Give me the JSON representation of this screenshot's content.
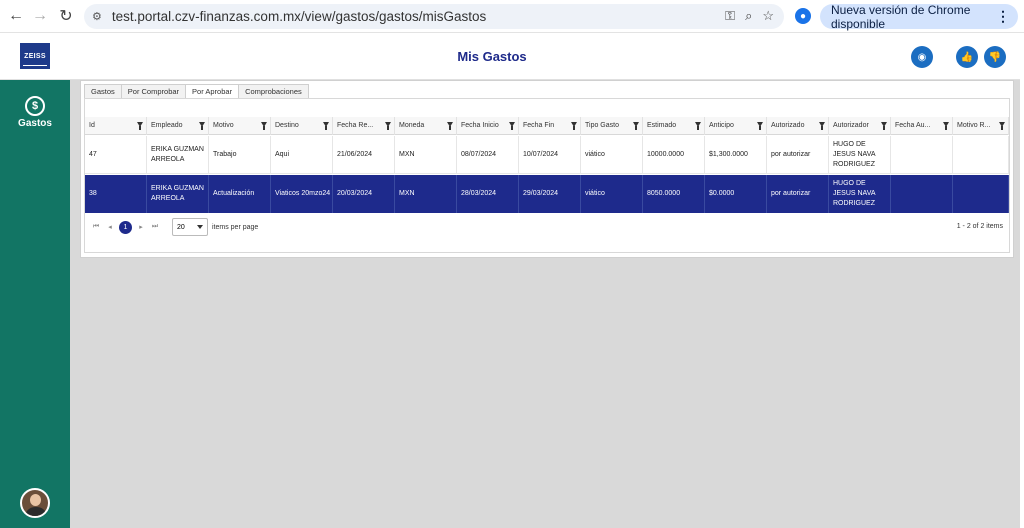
{
  "browser": {
    "url": "test.portal.czv-finanzas.com.mx/view/gastos/gastos/misGastos",
    "update_label": "Nueva versión de Chrome disponible"
  },
  "header": {
    "logo_text": "ZEISS",
    "title": "Mis Gastos"
  },
  "sidebar": {
    "items": [
      {
        "label": "Gastos",
        "icon": "money-cycle-icon"
      }
    ]
  },
  "tabs": [
    {
      "label": "Gastos",
      "active": false
    },
    {
      "label": "Por Comprobar",
      "active": false
    },
    {
      "label": "Por Aprobar",
      "active": true
    },
    {
      "label": "Comprobaciones",
      "active": false
    }
  ],
  "table": {
    "columns": [
      "Id",
      "Empleado",
      "Motivo",
      "Destino",
      "Fecha Re...",
      "Moneda",
      "Fecha Inicio",
      "Fecha Fin",
      "Tipo Gasto",
      "Estimado",
      "Anticipo",
      "Autorizado",
      "Autorizador",
      "Fecha Au...",
      "Motivo R..."
    ],
    "rows": [
      [
        "47",
        "ERIKA GUZMAN ARREOLA",
        "Trabajo",
        "Aqui",
        "21/06/2024",
        "MXN",
        "08/07/2024",
        "10/07/2024",
        "viático",
        "10000.0000",
        "$1,300.0000",
        "por autorizar",
        "HUGO DE JESUS NAVA RODRIGUEZ",
        "",
        ""
      ],
      [
        "38",
        "ERIKA GUZMAN ARREOLA",
        "Actualización",
        "Viaticos 20mzo24",
        "20/03/2024",
        "MXN",
        "28/03/2024",
        "29/03/2024",
        "viático",
        "8050.0000",
        "$0.0000",
        "por autorizar",
        "HUGO DE JESUS NAVA RODRIGUEZ",
        "",
        ""
      ]
    ]
  },
  "pager": {
    "current_page": "1",
    "page_size": "20",
    "items_per_page_label": "items per page",
    "info": "1 - 2 of 2 items"
  }
}
